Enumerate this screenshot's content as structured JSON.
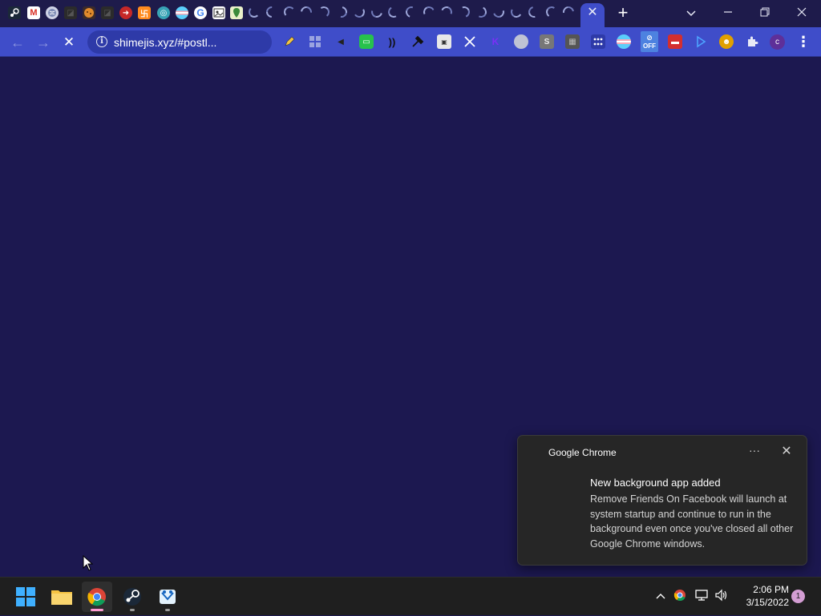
{
  "browser": {
    "address_bar": {
      "url": "shimejis.xyz/#postl..."
    },
    "profile_initial": "c",
    "extension_off_badge": "OFF",
    "extension_s_label": "S"
  },
  "tab_strip": {
    "favicons": [
      "steam-icon",
      "gmail-icon",
      "globe-icon",
      "dark-tile-icon",
      "cookie-icon",
      "dark-tile-icon",
      "red-arrow-icon",
      "orange-logo-icon",
      "teal-circle-icon",
      "flag-icon",
      "google-icon",
      "photo-icon",
      "map-icon"
    ],
    "loading_tab_count": 19
  },
  "notification": {
    "app_name": "Google Chrome",
    "title": "New background app added",
    "body": "Remove Friends On Facebook will launch at system startup and continue to run in the background even once you've closed all other Google Chrome windows."
  },
  "taskbar": {
    "apps": [
      "start",
      "file-explorer",
      "google-chrome",
      "steam",
      "shimeji"
    ],
    "clock": {
      "time": "2:06 PM",
      "date": "3/15/2022"
    },
    "notification_count": "1"
  },
  "colors": {
    "page_background": "#1c1850",
    "toolbar": "#3f4dc9",
    "tab_strip": "#1e1b4b",
    "taskbar": "#1f1f1f",
    "toast": "#262626"
  }
}
